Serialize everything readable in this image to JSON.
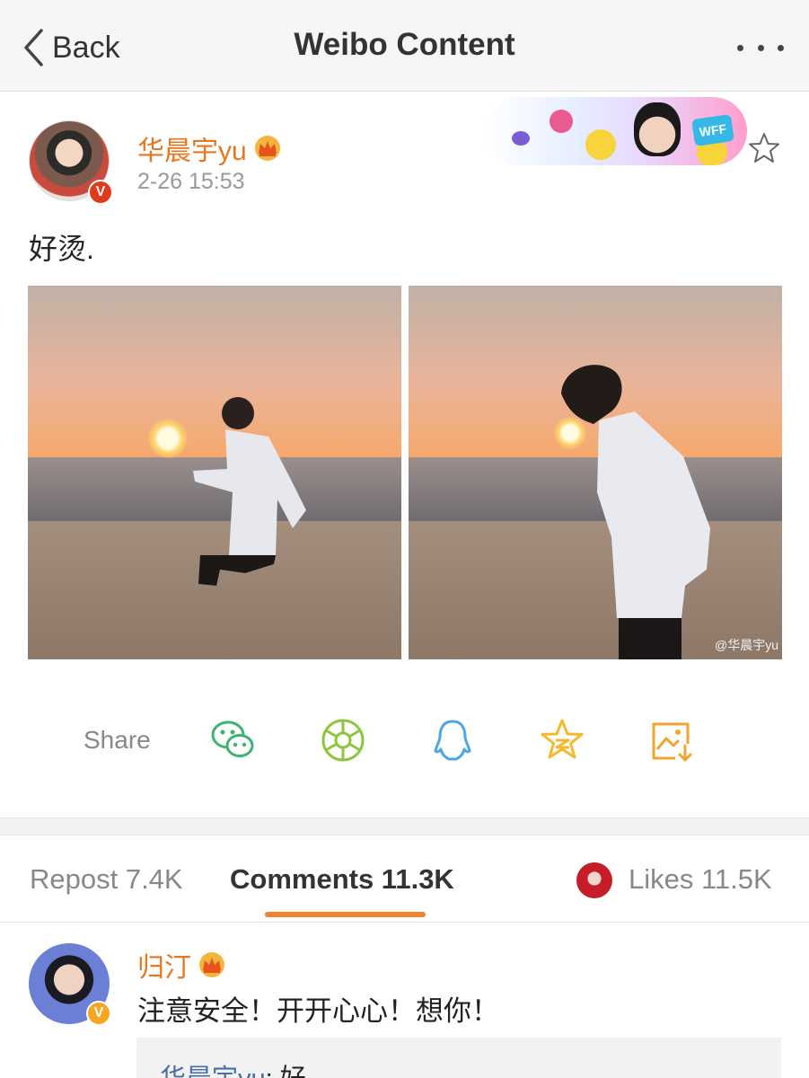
{
  "navbar": {
    "back_label": "Back",
    "title": "Weibo Content"
  },
  "post": {
    "username": "华晨宇yu",
    "timestamp": "2-26 15:53",
    "text": "好烫.",
    "images": [
      {
        "watermark": ""
      },
      {
        "watermark": "@华晨宇yu"
      }
    ],
    "banner_badge": "WFF"
  },
  "share": {
    "label": "Share",
    "icons": [
      "wechat-icon",
      "moments-icon",
      "qq-icon",
      "qzone-icon",
      "save-image-icon"
    ],
    "colors": {
      "wechat": "#3cb371",
      "moments": "#8cc63f",
      "qq": "#4ea6e6",
      "qzone": "#f5b82e",
      "save": "#f0a62e"
    }
  },
  "tabs": {
    "repost": "Repost 7.4K",
    "comments": "Comments 11.3K",
    "likes": "Likes 11.5K",
    "accent": "#ef8430"
  },
  "comment": {
    "username": "归汀",
    "text": "注意安全！开开心心！想你！",
    "reply_user": "华晨宇yu",
    "reply_text": ": 好"
  }
}
